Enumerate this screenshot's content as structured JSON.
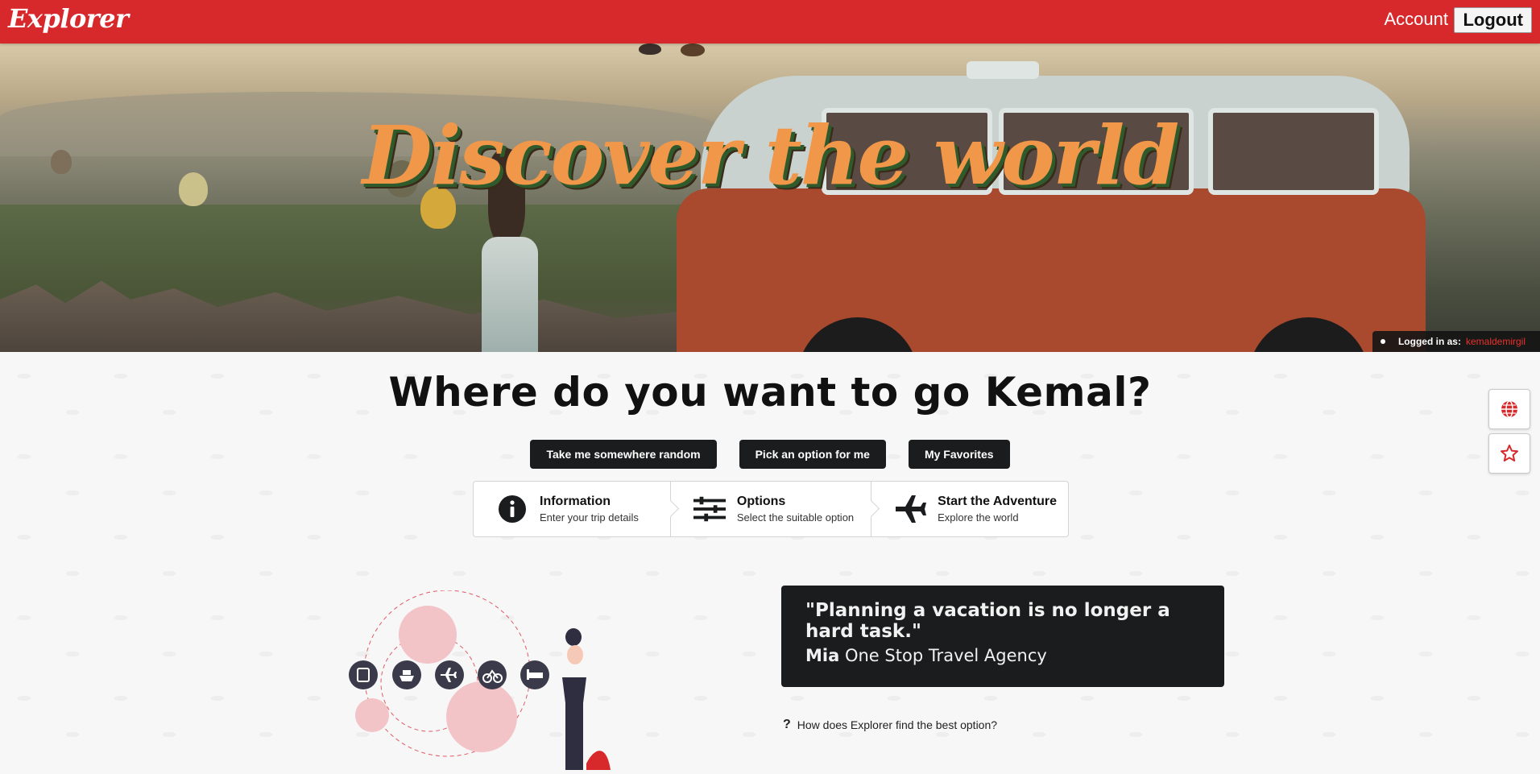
{
  "header": {
    "logo": "Explorer",
    "account_label": "Account",
    "logout_label": "Logout",
    "brand_color": "#d7282b"
  },
  "hero": {
    "title": "Discover the world",
    "login_prefix": "Logged in as:",
    "username": "kemaldemirgil"
  },
  "main": {
    "question": "Where do you want to go Kemal?",
    "buttons": [
      {
        "label": "Take me somewhere random"
      },
      {
        "label": "Pick an option for me"
      },
      {
        "label": "My Favorites"
      }
    ],
    "steps": [
      {
        "title": "Information",
        "description": "Enter your trip details",
        "icon": "info-circle-icon"
      },
      {
        "title": "Options",
        "description": "Select the suitable option",
        "icon": "sliders-icon"
      },
      {
        "title": "Start the Adventure",
        "description": "Explore the world",
        "icon": "plane-icon"
      }
    ],
    "quote": {
      "text": "\"Planning a vacation is no longer a hard task.\"",
      "author_name": "Mia",
      "author_org": "One Stop Travel Agency"
    },
    "faq_link": "How does Explorer find the best option?"
  },
  "side_buttons": [
    {
      "icon": "globe-icon"
    },
    {
      "icon": "star-icon"
    }
  ],
  "illustration_icons": [
    "bus-icon",
    "ship-icon",
    "plane-icon",
    "bicycle-icon",
    "bed-icon"
  ]
}
